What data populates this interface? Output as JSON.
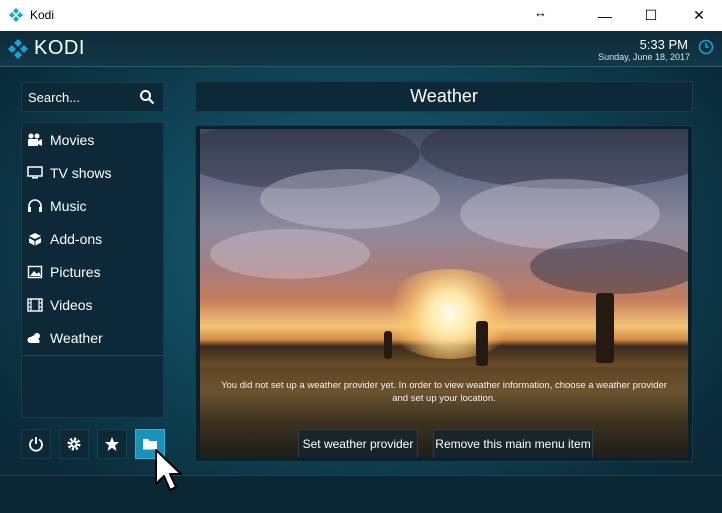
{
  "window": {
    "title": "Kodi",
    "resize_icon": "↔",
    "minimize": "—",
    "maximize": "☐",
    "close": "✕"
  },
  "header": {
    "logo_text": "KODI",
    "time": "5:33 PM",
    "date": "Sunday, June 18, 2017"
  },
  "search": {
    "label": "Search..."
  },
  "menu": {
    "items": [
      {
        "label": "Movies",
        "icon": "movie-camera-icon"
      },
      {
        "label": "TV shows",
        "icon": "tv-icon"
      },
      {
        "label": "Music",
        "icon": "headphones-icon"
      },
      {
        "label": "Add-ons",
        "icon": "box-icon"
      },
      {
        "label": "Pictures",
        "icon": "picture-icon"
      },
      {
        "label": "Videos",
        "icon": "film-icon"
      },
      {
        "label": "Weather",
        "icon": "weather-icon"
      }
    ]
  },
  "bottom_buttons": [
    {
      "icon": "power-icon"
    },
    {
      "icon": "gear-icon"
    },
    {
      "icon": "star-icon"
    },
    {
      "icon": "folder-icon",
      "active": true
    }
  ],
  "content": {
    "title": "Weather",
    "message": "You did not set up a weather provider yet. In order to view weather information, choose a weather provider and set up your location.",
    "set_provider_label": "Set weather provider",
    "remove_item_label": "Remove this main menu item"
  },
  "colors": {
    "accent": "#1a91b8",
    "background": "#0f4558"
  }
}
